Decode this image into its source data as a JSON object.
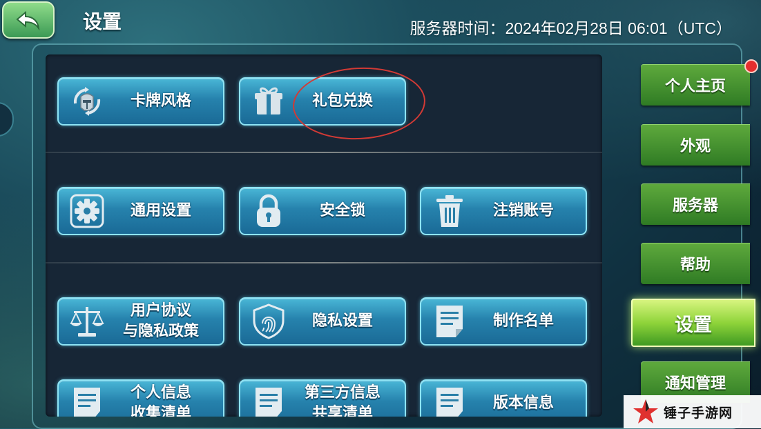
{
  "header": {
    "title": "设置",
    "server_time": "服务器时间：2024年02月28日 06:01（UTC）"
  },
  "cards": [
    {
      "label": "卡牌风格",
      "icon": "helmet-icon"
    },
    {
      "label": "礼包兑换",
      "icon": "gift-icon"
    },
    {
      "label": "通用设置",
      "icon": "gear-icon"
    },
    {
      "label": "安全锁",
      "icon": "lock-icon"
    },
    {
      "label": "注销账号",
      "icon": "trash-icon"
    },
    {
      "label_line1": "用户协议",
      "label_line2": "与隐私政策",
      "icon": "scale-icon"
    },
    {
      "label": "隐私设置",
      "icon": "fingerprint-shield-icon"
    },
    {
      "label": "制作名单",
      "icon": "document-icon"
    },
    {
      "label_line1": "个人信息",
      "label_line2": "收集清单",
      "icon": "document-icon"
    },
    {
      "label_line1": "第三方信息",
      "label_line2": "共享清单",
      "icon": "document-icon"
    },
    {
      "label": "版本信息",
      "icon": "document-icon"
    }
  ],
  "side_tabs": [
    {
      "label": "个人主页",
      "badge": true
    },
    {
      "label": "外观"
    },
    {
      "label": "服务器"
    },
    {
      "label": "帮助"
    },
    {
      "label": "设置",
      "active": true
    },
    {
      "label": "通知管理"
    }
  ],
  "watermark": {
    "text": "锤子手游网"
  },
  "colors": {
    "card_fill": "#2682ad",
    "card_border": "#8ee4f5",
    "tab_green": "#3f9a22",
    "highlight_red": "#d23a35",
    "badge_red": "#e52e2e"
  }
}
